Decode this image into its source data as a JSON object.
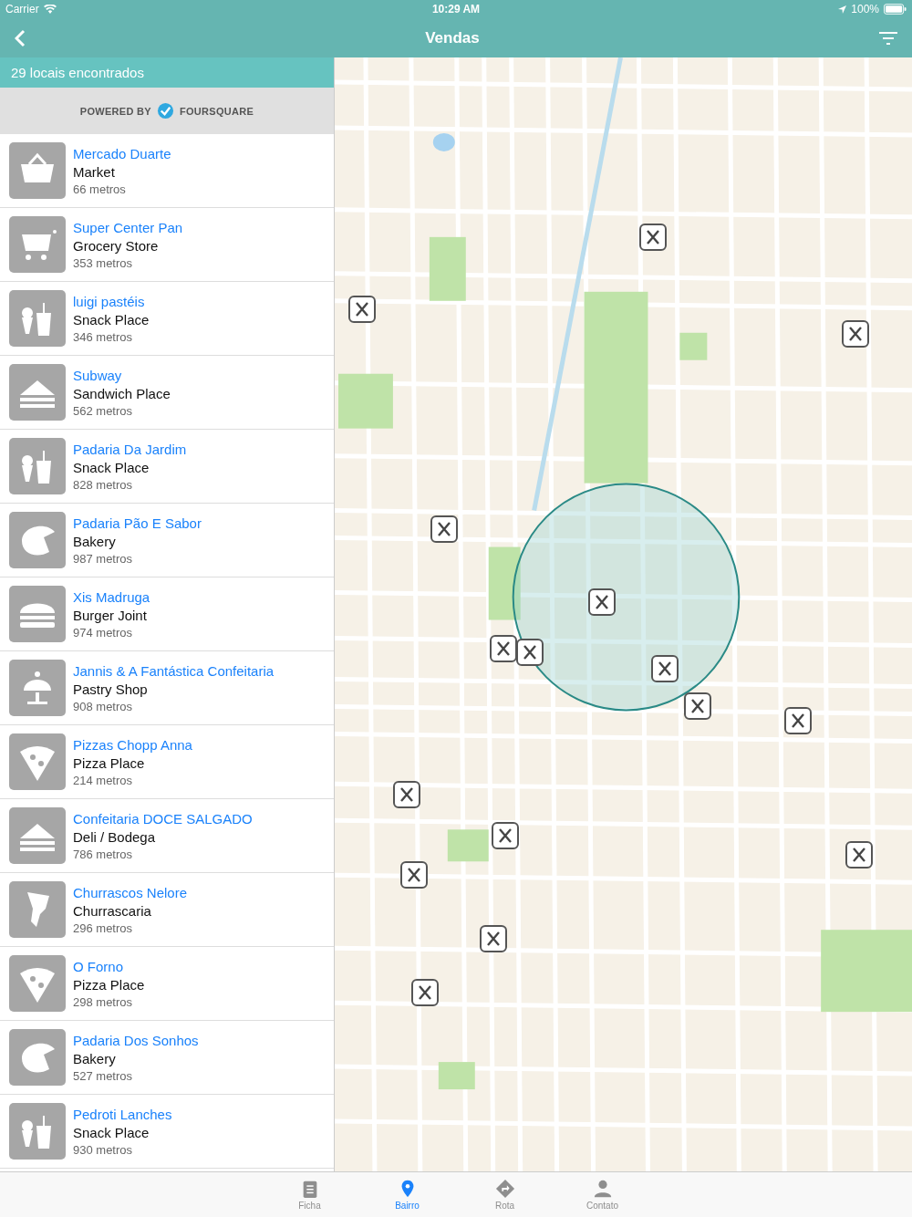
{
  "status_bar": {
    "carrier": "Carrier",
    "time": "10:29 AM",
    "battery": "100%"
  },
  "nav": {
    "title": "Vendas"
  },
  "results": {
    "count": "29 locais encontrados",
    "powered_by": "POWERED BY",
    "provider": "FOURSQUARE"
  },
  "places": [
    {
      "name": "Mercado Duarte",
      "category": "Market",
      "distance": "66 metros",
      "kind": "market"
    },
    {
      "name": "Super Center Pan",
      "category": "Grocery Store",
      "distance": "353 metros",
      "kind": "grocery"
    },
    {
      "name": "luigi pastéis",
      "category": "Snack Place",
      "distance": "346 metros",
      "kind": "snack"
    },
    {
      "name": "Subway",
      "category": "Sandwich Place",
      "distance": "562 metros",
      "kind": "sandwich"
    },
    {
      "name": "Padaria Da Jardim",
      "category": "Snack Place",
      "distance": "828 metros",
      "kind": "snack"
    },
    {
      "name": "Padaria Pão E Sabor",
      "category": "Bakery",
      "distance": "987 metros",
      "kind": "bakery"
    },
    {
      "name": "Xis Madruga",
      "category": "Burger Joint",
      "distance": "974 metros",
      "kind": "burger"
    },
    {
      "name": "Jannis & A Fantástica Confeitaria",
      "category": "Pastry Shop",
      "distance": "908 metros",
      "kind": "pastry"
    },
    {
      "name": "Pizzas Chopp Anna",
      "category": "Pizza Place",
      "distance": "214 metros",
      "kind": "pizza"
    },
    {
      "name": "Confeitaria DOCE SALGADO",
      "category": "Deli / Bodega",
      "distance": "786 metros",
      "kind": "sandwich"
    },
    {
      "name": "Churrascos Nelore",
      "category": "Churrascaria",
      "distance": "296 metros",
      "kind": "churrasco"
    },
    {
      "name": "O Forno",
      "category": "Pizza Place",
      "distance": "298 metros",
      "kind": "pizza"
    },
    {
      "name": "Padaria Dos Sonhos",
      "category": "Bakery",
      "distance": "527 metros",
      "kind": "bakery"
    },
    {
      "name": "Pedroti Lanches",
      "category": "Snack Place",
      "distance": "930 metros",
      "kind": "snack"
    }
  ],
  "tabs": [
    {
      "label": "Ficha",
      "kind": "clipboard",
      "selected": false
    },
    {
      "label": "Bairro",
      "kind": "pin",
      "selected": true
    },
    {
      "label": "Rota",
      "kind": "route",
      "selected": false
    },
    {
      "label": "Contato",
      "kind": "person",
      "selected": false
    }
  ]
}
